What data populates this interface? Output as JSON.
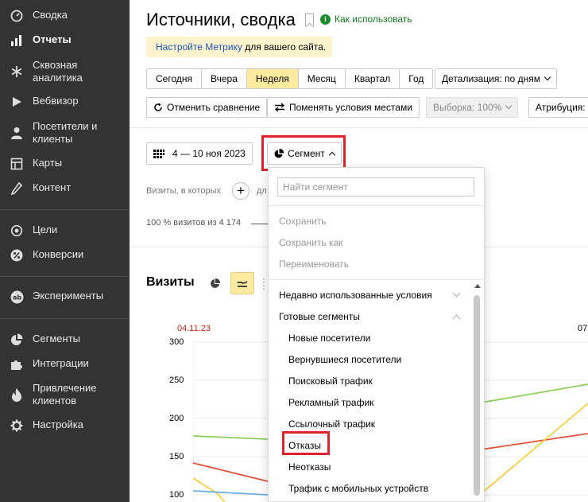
{
  "sidebar": {
    "items": [
      {
        "icon": "gauge-icon",
        "label": "Сводка",
        "active": false
      },
      {
        "icon": "bar-chart-icon",
        "label": "Отчеты",
        "active": true
      },
      {
        "icon": "asterisk-icon",
        "label": "Сквозная аналитика",
        "active": false
      },
      {
        "icon": "play-icon",
        "label": "Вебвизор",
        "active": false
      },
      {
        "icon": "person-icon",
        "label": "Посетители и клиенты",
        "active": false
      },
      {
        "icon": "map-icon",
        "label": "Карты",
        "active": false
      },
      {
        "icon": "pencil-icon",
        "label": "Контент",
        "active": false
      },
      {
        "icon": "target-icon",
        "label": "Цели",
        "active": false
      },
      {
        "icon": "percent-icon",
        "label": "Конверсии",
        "active": false
      },
      {
        "icon": "ab-icon",
        "label": "Эксперименты",
        "active": false
      },
      {
        "icon": "pie-icon",
        "label": "Сегменты",
        "active": false
      },
      {
        "icon": "puzzle-icon",
        "label": "Интеграции",
        "active": false
      },
      {
        "icon": "fire-icon",
        "label": "Привлечение клиентов",
        "active": false
      },
      {
        "icon": "gear-icon",
        "label": "Настройка",
        "active": false
      }
    ]
  },
  "header": {
    "title": "Источники, сводка",
    "help_link": "Как использовать",
    "notice_link": "Настройте Метрику",
    "notice_text": " для вашего сайта."
  },
  "period": {
    "options": [
      "Сегодня",
      "Вчера",
      "Неделя",
      "Месяц",
      "Квартал",
      "Год"
    ],
    "selected": "Неделя",
    "detail_label": "Детализация: по дням"
  },
  "toolbar": {
    "cancel_compare": "Отменить сравнение",
    "swap_conditions": "Поменять условия местами",
    "sample": "Выборка: 100%",
    "attribution": "Атрибуция:"
  },
  "filters": {
    "date_range": "4 — 10 ноя 2023",
    "segment_button": "Сегмент",
    "visits_condition": "Визиты, в которых",
    "visits_condition_tail": "дл",
    "visits_share": "100 % визитов из 4 174"
  },
  "chart": {
    "title": "Визиты",
    "date_left": "04.11.23",
    "date_right": "07",
    "y_ticks": [
      "300",
      "250",
      "200",
      "150",
      "100"
    ],
    "colors": {
      "green": "#8bcf5a",
      "red": "#e2513a",
      "yellow": "#f2d04a",
      "blue": "#6fb0e6"
    }
  },
  "dropdown": {
    "search_placeholder": "Найти сегмент",
    "actions": [
      "Сохранить",
      "Сохранить как",
      "Переименовать"
    ],
    "group_recent": "Недавно использованные условия",
    "group_ready": "Готовые сегменты",
    "segments": [
      "Новые посетители",
      "Вернувшиеся посетители",
      "Поисковый трафик",
      "Рекламный трафик",
      "Ссылочный трафик",
      "Отказы",
      "Неотказы",
      "Трафик с мобильных устройств"
    ],
    "highlighted": "Отказы"
  }
}
